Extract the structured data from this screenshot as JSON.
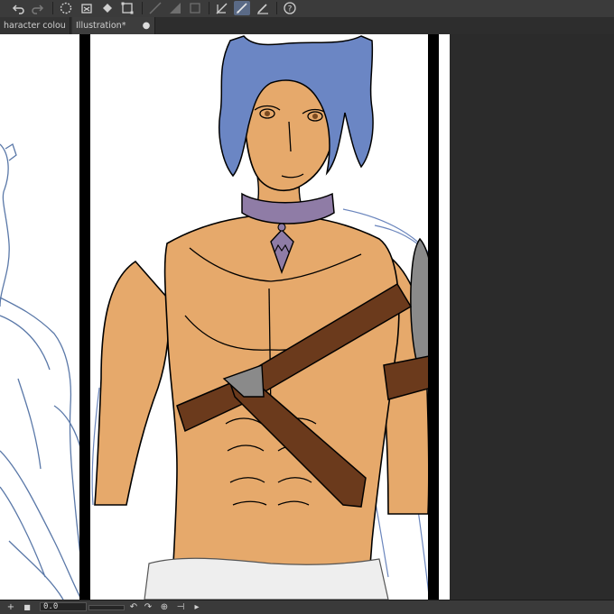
{
  "toolbar": {
    "tools": [
      "undo-icon",
      "redo-icon",
      "ellipse-select-icon",
      "clear-icon",
      "fill-icon",
      "transform-icon",
      "ruler-icon",
      "gradient-icon",
      "crop-icon",
      "vector-pen-icon",
      "brush-icon",
      "pencil-edit-icon",
      "help-icon"
    ],
    "active_tool": "brush-icon"
  },
  "tabs": [
    {
      "label": "haracter colou",
      "close": "×",
      "active": false
    },
    {
      "label": "Illustration*",
      "close": "●",
      "active": true
    }
  ],
  "canvas": {
    "title": "Illustration*",
    "colors": {
      "skin": "#e6a96b",
      "hair": "#6b86c4",
      "strap": "#6b3a1c",
      "collar": "#8f7ca6",
      "metal": "#8a8a8a",
      "sketch": "#5a78a8",
      "paper": "#ffffff",
      "panel_border": "#000000"
    }
  },
  "statusbar": {
    "zoom_value": "0.0",
    "add": "+",
    "stop": "■",
    "rotate_left": "↶",
    "rotate_right": "↷",
    "reset": "⊕",
    "flip": "⊣",
    "position": "▸"
  }
}
